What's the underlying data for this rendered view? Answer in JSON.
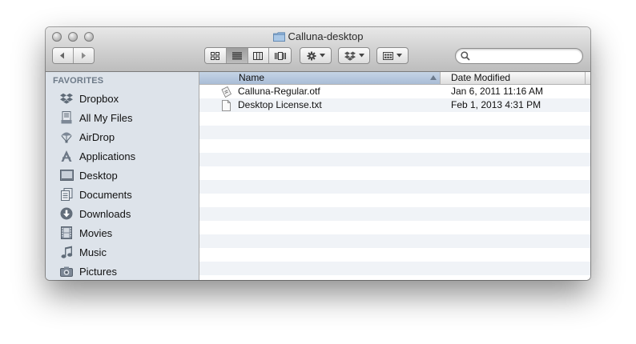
{
  "window": {
    "title": "Calluna-desktop"
  },
  "toolbar": {
    "nav": {
      "back_icon": "chevron-left-icon",
      "forward_icon": "chevron-right-icon"
    },
    "view_modes": [
      "icon-view-icon",
      "list-view-icon",
      "column-view-icon",
      "coverflow-view-icon"
    ],
    "active_view": "list-view-icon",
    "action_icon": "gear-icon",
    "dropbox_icon": "dropbox-icon",
    "arrange_icon": "arrange-icon",
    "search": {
      "placeholder": ""
    }
  },
  "sidebar": {
    "section_label": "FAVORITES",
    "items": [
      {
        "label": "Dropbox",
        "icon": "dropbox-icon"
      },
      {
        "label": "All My Files",
        "icon": "all-my-files-icon"
      },
      {
        "label": "AirDrop",
        "icon": "airdrop-icon"
      },
      {
        "label": "Applications",
        "icon": "applications-icon"
      },
      {
        "label": "Desktop",
        "icon": "desktop-icon"
      },
      {
        "label": "Documents",
        "icon": "documents-icon"
      },
      {
        "label": "Downloads",
        "icon": "downloads-icon"
      },
      {
        "label": "Movies",
        "icon": "movies-icon"
      },
      {
        "label": "Music",
        "icon": "music-icon"
      },
      {
        "label": "Pictures",
        "icon": "pictures-icon"
      }
    ]
  },
  "list": {
    "columns": {
      "name": "Name",
      "date": "Date Modified"
    },
    "files": [
      {
        "name": "Calluna-Regular.otf",
        "date": "Jan 6, 2011 11:16 AM",
        "icon": "font-file-icon"
      },
      {
        "name": "Desktop License.txt",
        "date": "Feb 1, 2013 4:31 PM",
        "icon": "text-file-icon"
      }
    ]
  },
  "colors": {
    "sidebar_bg": "#dde3ea",
    "header_sort_bg": "#b8c9de",
    "row_alt": "#f0f3f7"
  }
}
